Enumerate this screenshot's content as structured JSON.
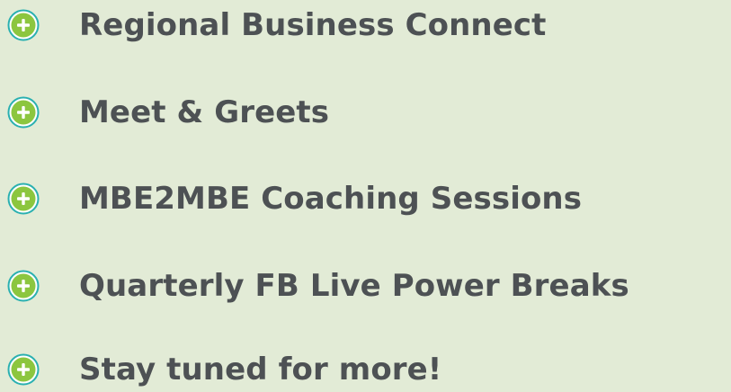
{
  "list": {
    "items": [
      {
        "label": "Regional Business Connect",
        "icon": "plus-circle-icon"
      },
      {
        "label": "Meet & Greets",
        "icon": "plus-circle-icon"
      },
      {
        "label": "MBE2MBE Coaching Sessions",
        "icon": "plus-circle-icon"
      },
      {
        "label": "Quarterly FB Live Power Breaks",
        "icon": "plus-circle-icon"
      },
      {
        "label": "Stay tuned for more!",
        "icon": "plus-circle-icon"
      }
    ]
  },
  "colors": {
    "background": "#e2ebd6",
    "text": "#4d5154",
    "icon_fill": "#8cc63f",
    "icon_ring": "#2ab0b0",
    "icon_plus": "#ffffff"
  }
}
